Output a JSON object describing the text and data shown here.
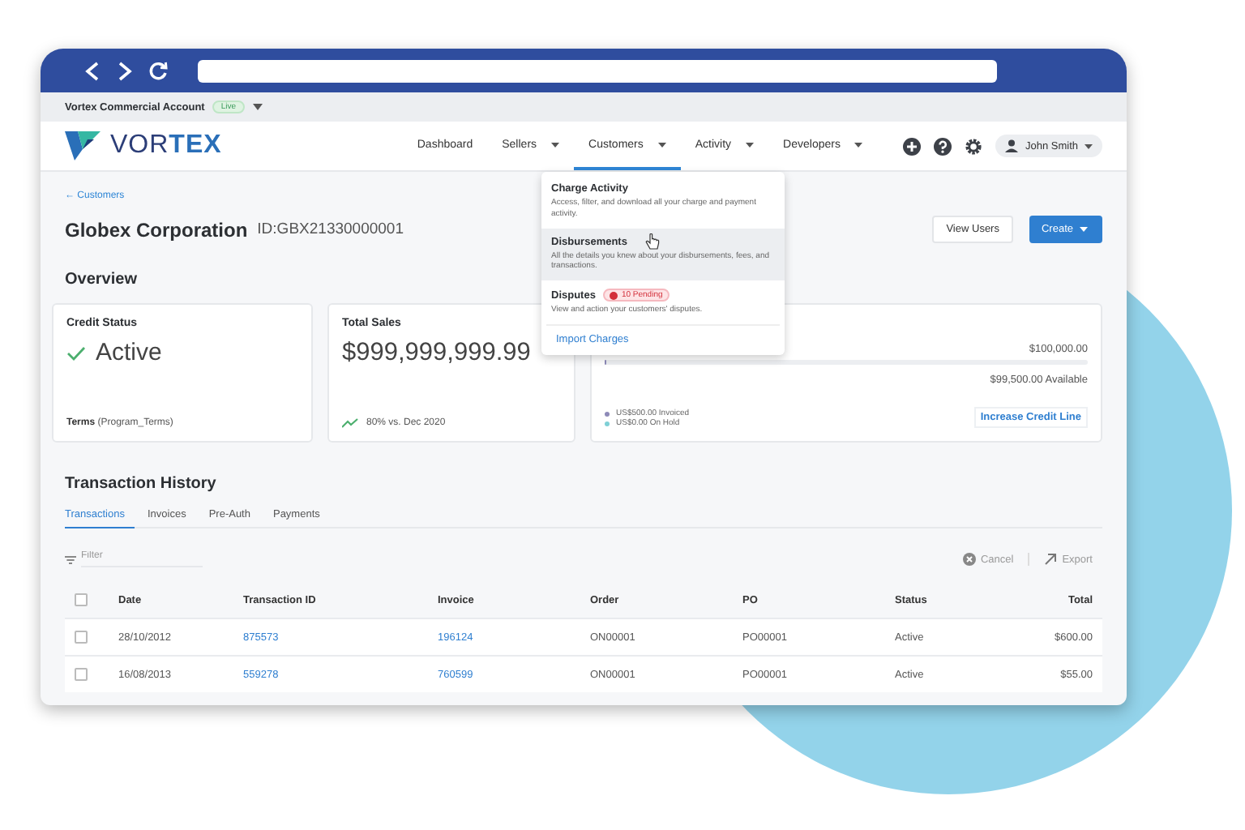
{
  "account": {
    "name": "Vortex Commercial Account",
    "badge": "Live"
  },
  "logo": {
    "light": "VOR",
    "bold": "TEX"
  },
  "nav": [
    {
      "label": "Dashboard",
      "dropdown": false,
      "selected": false
    },
    {
      "label": "Sellers",
      "dropdown": true,
      "selected": false
    },
    {
      "label": "Customers",
      "dropdown": true,
      "selected": true
    },
    {
      "label": "Activity",
      "dropdown": true,
      "selected": false
    },
    {
      "label": "Developers",
      "dropdown": true,
      "selected": false
    }
  ],
  "user": {
    "name": "John Smith"
  },
  "menu": [
    {
      "kind": "option",
      "title": "Charge Activity",
      "description": "Access, filter, and download all your charge and payment activity.",
      "highlighted": false
    },
    {
      "kind": "option",
      "title": "Disbursements",
      "description": "All the details you knew about your disbursements, fees, and transactions.",
      "highlighted": true
    },
    {
      "kind": "option",
      "title": "Disputes",
      "badge": "10 Pending",
      "description": "View and action your customers' disputes.",
      "highlighted": false
    },
    {
      "kind": "link",
      "title": "Import Charges"
    }
  ],
  "header": {
    "back": "← Customers",
    "title": "Globex Corporation",
    "id": "ID:GBX21330000001",
    "buttons": [
      {
        "label": "View Users",
        "kind": "secondary"
      },
      {
        "label": "Create",
        "kind": "primary"
      }
    ]
  },
  "overview": {
    "heading": "Overview",
    "credit_status": {
      "title": "Credit Status",
      "value": "Active",
      "terms_label": "Terms",
      "terms_value": "(Program_Terms)"
    },
    "total_sales": {
      "title": "Total Sales",
      "value": "$999,999,999.99",
      "trend": "80% vs. Dec 2020"
    },
    "credit_line": {
      "limit": "$100,000.00",
      "level": 0.005,
      "available": "$99,500.00 Available",
      "legend": [
        {
          "label": "US$500.00 Invoiced",
          "color": "#8e8ab8"
        },
        {
          "label": "US$0.00 On Hold",
          "color": "#7fd0d6"
        }
      ],
      "button": "Increase Credit Line"
    }
  },
  "history": {
    "heading": "Transaction History",
    "tabs": [
      {
        "label": "Transactions",
        "selected": true
      },
      {
        "label": "Invoices",
        "selected": false
      },
      {
        "label": "Pre-Auth",
        "selected": false
      },
      {
        "label": "Payments",
        "selected": false
      }
    ],
    "filter": {
      "placeholder": "Filter"
    },
    "actions": [
      "Cancel",
      "Export"
    ],
    "columns": [
      "Date",
      "Transaction ID",
      "Invoice",
      "Order",
      "PO",
      "Status",
      "Total"
    ],
    "header_checked": false,
    "rows": [
      {
        "checked": false,
        "cells": [
          "28/10/2012",
          "875573",
          "196124",
          "ON00001",
          "PO00001",
          "Active",
          "$600.00"
        ]
      },
      {
        "checked": false,
        "cells": [
          "16/08/2013",
          "559278",
          "760599",
          "ON00001",
          "PO00001",
          "Active",
          "$55.00"
        ]
      }
    ]
  }
}
